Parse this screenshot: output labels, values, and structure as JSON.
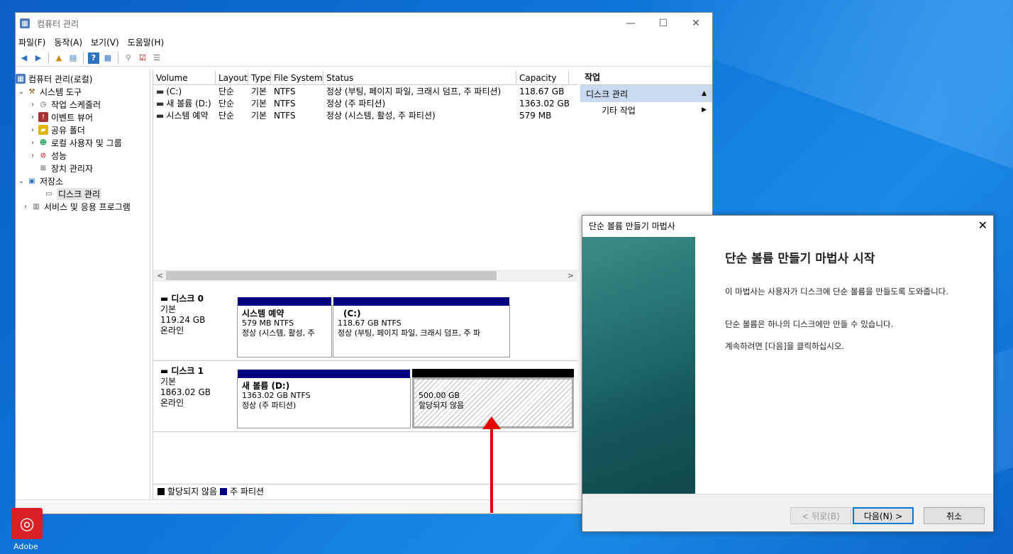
{
  "main_window": {
    "title": "컴퓨터 관리",
    "min": "—",
    "max": "☐",
    "close": "✕",
    "menu": [
      "파일(F)",
      "동작(A)",
      "보기(V)",
      "도움말(H)"
    ]
  },
  "tree": {
    "root": "컴퓨터 관리(로컬)",
    "system_tools": "시스템 도구",
    "task_scheduler": "작업 스케줄러",
    "event_viewer": "이벤트 뷰어",
    "shared_folders": "공유 폴더",
    "local_users": "로컬 사용자 및 그룹",
    "performance": "성능",
    "device_manager": "장치 관리자",
    "storage": "저장소",
    "disk_mgmt": "디스크 관리",
    "services": "서비스 및 응용 프로그램"
  },
  "volume_table": {
    "headers": [
      "Volume",
      "Layout",
      "Type",
      "File System",
      "Status",
      "Capacity"
    ],
    "rows": [
      {
        "volume": "(C:)",
        "layout": "단순",
        "type": "기본",
        "fs": "NTFS",
        "status": "정상 (부팅, 페이지 파일, 크래시 덤프, 주 파티션)",
        "capacity": "118.67 GB"
      },
      {
        "volume": "새 볼륨 (D:)",
        "layout": "단순",
        "type": "기본",
        "fs": "NTFS",
        "status": "정상 (주 파티션)",
        "capacity": "1363.02 GB"
      },
      {
        "volume": "시스템 예약",
        "layout": "단순",
        "type": "기본",
        "fs": "NTFS",
        "status": "정상 (시스템, 활성, 주 파티션)",
        "capacity": "579 MB"
      }
    ]
  },
  "disks": [
    {
      "name": "디스크 0",
      "type": "기본",
      "size": "119.24 GB",
      "state": "온라인",
      "parts": [
        {
          "title": "시스템 예약",
          "size": "579 MB NTFS",
          "status": "정상 (시스템, 활성, 주"
        },
        {
          "title": "(C:)",
          "size": "118.67 GB NTFS",
          "status": "정상 (부팅, 페이지 파일, 크래시 덤프, 주 파"
        }
      ]
    },
    {
      "name": "디스크 1",
      "type": "기본",
      "size": "1863.02 GB",
      "state": "온라인",
      "parts": [
        {
          "title": "새 볼륨  (D:)",
          "size": "1363.02 GB NTFS",
          "status": "정상 (주 파티션)"
        },
        {
          "title": "",
          "size": "500.00 GB",
          "status": "할당되지 않음"
        }
      ]
    }
  ],
  "legend": {
    "unallocated": "할당되지 않음",
    "primary": "주 파티션"
  },
  "actions": {
    "header": "작업",
    "selected": "디스크 관리",
    "more": "기타 작업"
  },
  "wizard": {
    "title": "단순 볼륨 만들기 마법사",
    "close": "✕",
    "heading": "단순 볼륨 만들기 마법사 시작",
    "p1": "이 마법사는 사용자가 디스크에 단순 볼륨을 만들도록 도와줍니다.",
    "p2": "단순 볼륨은 하나의 디스크에만 만들 수 있습니다.",
    "p3": "계속하려면 [다음]을 클릭하십시오.",
    "back": "< 뒤로(B)",
    "next": "다음(N) >",
    "cancel": "취소"
  },
  "desktop": {
    "icon_label": "Adobe"
  },
  "colors": {
    "primary_partition": "#000080",
    "unallocated": "#000000",
    "accent_arrow": "#e60000"
  }
}
